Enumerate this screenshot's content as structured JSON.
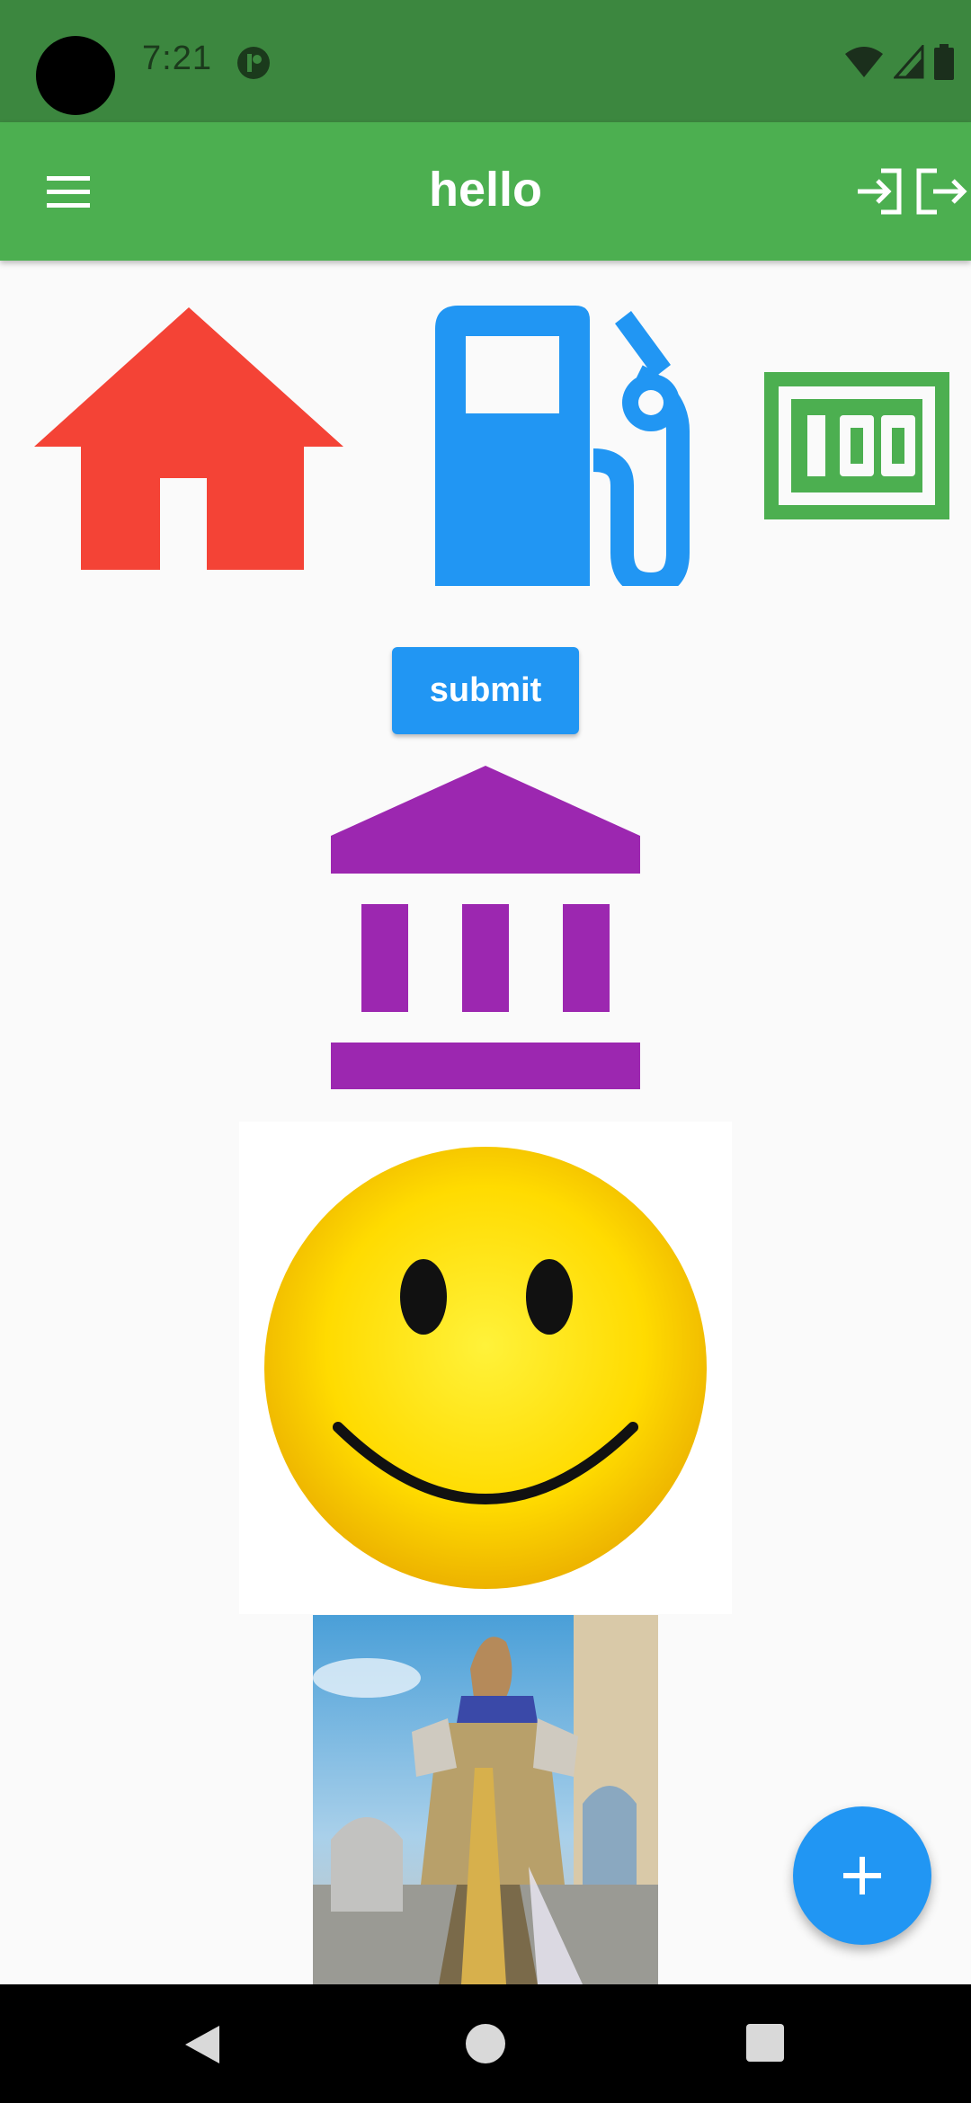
{
  "status_bar": {
    "time": "7:21"
  },
  "app_bar": {
    "title": "hello"
  },
  "content": {
    "submit_label": "submit"
  },
  "colors": {
    "status_bar": "#3c873f",
    "app_bar": "#4caf50",
    "home_icon": "#f44336",
    "gas_icon": "#2196f3",
    "hundred_icon": "#4caf50",
    "bank_icon": "#9c27b0",
    "accent": "#2196f3"
  },
  "icons": {
    "menu": "menu-icon",
    "login": "login-icon",
    "logout": "logout-icon",
    "home": "home-icon",
    "gas_station": "local-gas-station-icon",
    "hundred": "hundred-points-icon",
    "bank": "account-balance-icon",
    "smiley": "smiley-face-icon",
    "fab": "add-icon"
  },
  "images": {
    "smiley": "smiling face emoji",
    "hero": "armored game hero character"
  }
}
